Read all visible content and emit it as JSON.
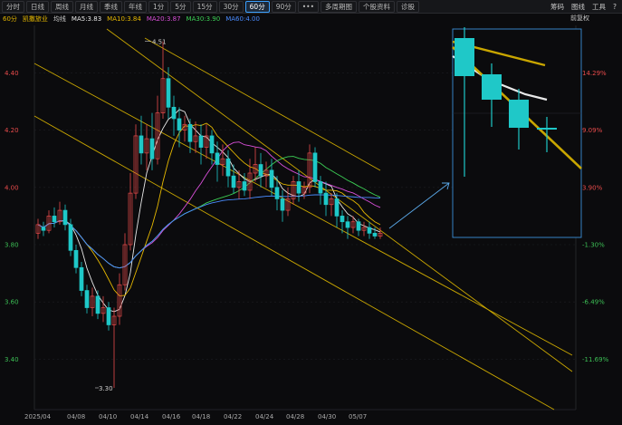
{
  "toolbar": {
    "tabs": [
      "分时",
      "日线",
      "周线",
      "月线",
      "季线",
      "年线",
      "1分",
      "5分",
      "15分",
      "30分",
      "60分",
      "90分",
      "•••",
      "多周期图",
      "个股资料",
      "诊股"
    ],
    "active_tab": "60分",
    "right": [
      "筹码",
      "图线",
      "工具",
      "?"
    ]
  },
  "info": {
    "period": "60分",
    "stock_name": "凯撒旅业",
    "avg_label": "均线",
    "ma": [
      {
        "label": "MA5:3.83",
        "color": "#e8e8e8"
      },
      {
        "label": "MA10:3.84",
        "color": "#e6b800"
      },
      {
        "label": "MA20:3.87",
        "color": "#d94fd9"
      },
      {
        "label": "MA30:3.90",
        "color": "#3ccf55"
      },
      {
        "label": "MA60:4.00",
        "color": "#4a8cff"
      }
    ],
    "restore": "前复权"
  },
  "chart_data": {
    "type": "candlestick",
    "y_left_ticks": [
      "4.40",
      "4.20",
      "4.00",
      "3.80",
      "3.60",
      "3.40"
    ],
    "y_right_ticks": [
      "14.29%",
      "9.09%",
      "3.90%",
      "-1.30%",
      "-6.49%",
      "-11.69%"
    ],
    "x_ticks": [
      "2025/04",
      "04/08",
      "04/10",
      "04/14",
      "04/16",
      "04/18",
      "04/22",
      "04/24",
      "04/28",
      "04/30",
      "05/07"
    ],
    "ylim": [
      3.3,
      4.58
    ],
    "annotations": [
      {
        "text": "4.51",
        "value": 4.51
      },
      {
        "text": "3.30",
        "value": 3.3
      }
    ],
    "candles": [
      [
        3.84,
        3.87,
        3.89,
        3.82
      ],
      [
        3.86,
        3.85,
        3.88,
        3.83
      ],
      [
        3.85,
        3.9,
        3.92,
        3.84
      ],
      [
        3.9,
        3.88,
        3.93,
        3.86
      ],
      [
        3.88,
        3.92,
        3.95,
        3.87
      ],
      [
        3.92,
        3.87,
        3.94,
        3.85
      ],
      [
        3.87,
        3.78,
        3.89,
        3.76
      ],
      [
        3.78,
        3.72,
        3.8,
        3.7
      ],
      [
        3.72,
        3.64,
        3.74,
        3.62
      ],
      [
        3.64,
        3.58,
        3.66,
        3.56
      ],
      [
        3.58,
        3.62,
        3.65,
        3.55
      ],
      [
        3.62,
        3.56,
        3.64,
        3.54
      ],
      [
        3.56,
        3.58,
        3.62,
        3.53
      ],
      [
        3.58,
        3.52,
        3.6,
        3.5
      ],
      [
        3.52,
        3.55,
        3.58,
        3.3
      ],
      [
        3.55,
        3.66,
        3.7,
        3.52
      ],
      [
        3.66,
        3.8,
        3.84,
        3.64
      ],
      [
        3.8,
        3.98,
        4.05,
        3.78
      ],
      [
        3.98,
        4.18,
        4.22,
        3.96
      ],
      [
        4.18,
        4.12,
        4.25,
        4.08
      ],
      [
        4.12,
        4.17,
        4.22,
        4.06
      ],
      [
        4.17,
        4.1,
        4.26,
        4.06
      ],
      [
        4.1,
        4.26,
        4.32,
        4.08
      ],
      [
        4.26,
        4.38,
        4.51,
        4.24
      ],
      [
        4.38,
        4.28,
        4.42,
        4.24
      ],
      [
        4.28,
        4.24,
        4.32,
        4.18
      ],
      [
        4.24,
        4.2,
        4.28,
        4.14
      ],
      [
        4.2,
        4.22,
        4.25,
        4.16
      ],
      [
        4.22,
        4.16,
        4.24,
        4.12
      ],
      [
        4.16,
        4.18,
        4.23,
        4.12
      ],
      [
        4.18,
        4.14,
        4.22,
        4.08
      ],
      [
        4.14,
        4.18,
        4.22,
        4.1
      ],
      [
        4.18,
        4.12,
        4.2,
        4.08
      ],
      [
        4.12,
        4.08,
        4.16,
        4.02
      ],
      [
        4.08,
        4.1,
        4.15,
        4.04
      ],
      [
        4.1,
        4.04,
        4.13,
        4.0
      ],
      [
        4.04,
        4.0,
        4.08,
        3.98
      ],
      [
        4.0,
        4.02,
        4.06,
        3.96
      ],
      [
        4.02,
        3.99,
        4.05,
        3.97
      ],
      [
        3.99,
        4.05,
        4.1,
        3.96
      ],
      [
        4.05,
        4.08,
        4.14,
        4.02
      ],
      [
        4.08,
        4.04,
        4.12,
        4.0
      ],
      [
        4.04,
        4.06,
        4.09,
        4.0
      ],
      [
        4.06,
        4.0,
        4.1,
        3.97
      ],
      [
        4.0,
        3.96,
        4.04,
        3.92
      ],
      [
        3.96,
        3.92,
        3.99,
        3.88
      ],
      [
        3.92,
        3.96,
        4.0,
        3.9
      ],
      [
        3.96,
        4.02,
        4.04,
        3.94
      ],
      [
        4.02,
        3.98,
        4.06,
        3.95
      ],
      [
        3.98,
        4.0,
        4.02,
        3.96
      ],
      [
        4.0,
        4.12,
        4.15,
        3.98
      ],
      [
        4.12,
        4.02,
        4.14,
        4.0
      ],
      [
        4.02,
        3.98,
        4.04,
        3.94
      ],
      [
        3.98,
        3.94,
        4.02,
        3.9
      ],
      [
        3.94,
        3.96,
        3.98,
        3.9
      ],
      [
        3.96,
        3.9,
        3.98,
        3.86
      ],
      [
        3.9,
        3.88,
        3.92,
        3.84
      ],
      [
        3.88,
        3.86,
        3.9,
        3.82
      ],
      [
        3.86,
        3.88,
        3.9,
        3.84
      ],
      [
        3.88,
        3.85,
        3.89,
        3.83
      ],
      [
        3.85,
        3.86,
        3.88,
        3.83
      ],
      [
        3.86,
        3.84,
        3.88,
        3.82
      ],
      [
        3.84,
        3.83,
        3.86,
        3.82
      ],
      [
        3.83,
        3.84,
        3.86,
        3.82
      ]
    ]
  }
}
